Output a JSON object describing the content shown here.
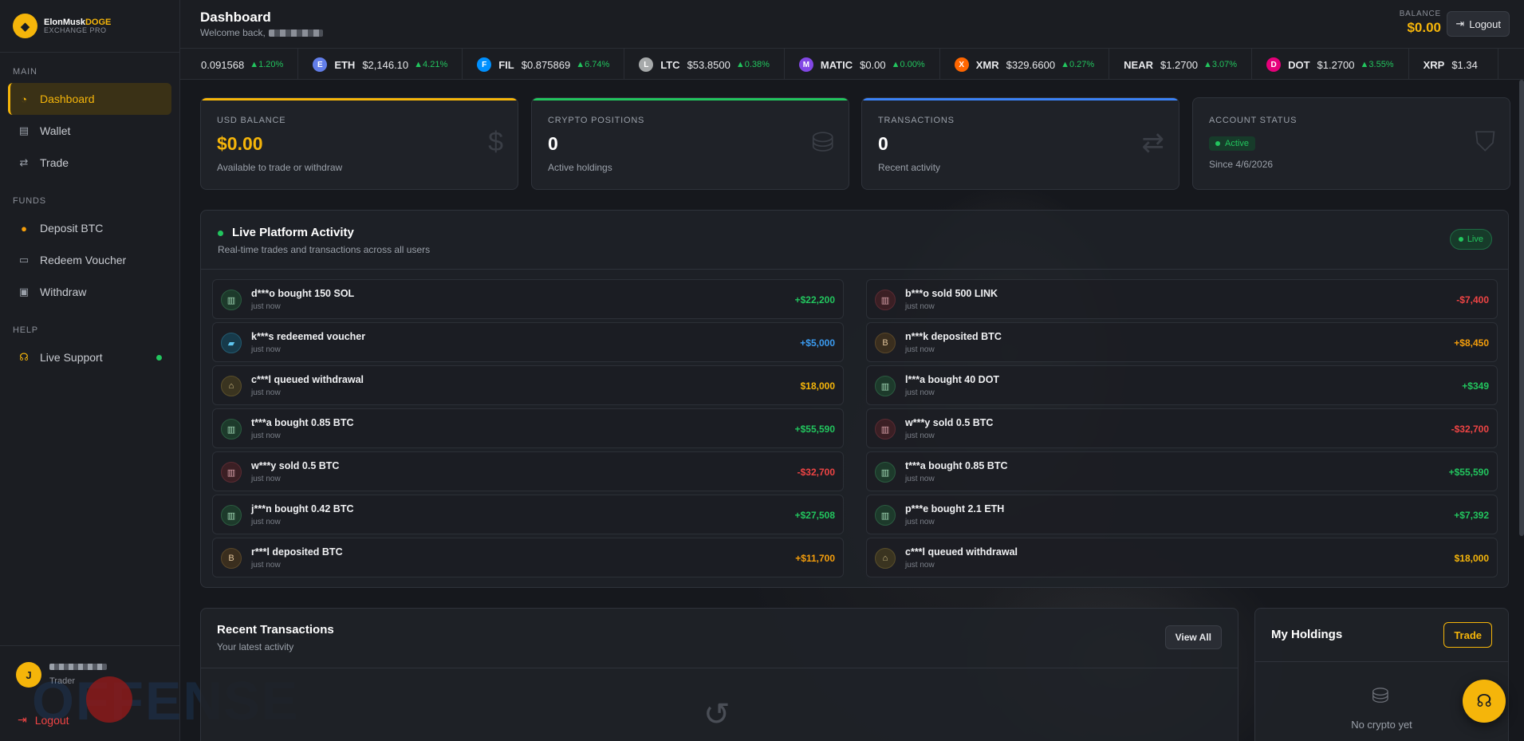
{
  "brand": {
    "name_main": "ElonMusk",
    "name_accent": "DOGE",
    "subtitle": "EXCHANGE PRO",
    "logo_icon": "doge-icon"
  },
  "sidebar": {
    "sections": [
      {
        "title": "MAIN",
        "items": [
          {
            "label": "Dashboard",
            "icon": "dashboard-icon",
            "active": true
          },
          {
            "label": "Wallet",
            "icon": "wallet-icon"
          },
          {
            "label": "Trade",
            "icon": "trade-arrows-icon"
          }
        ]
      },
      {
        "title": "FUNDS",
        "items": [
          {
            "label": "Deposit BTC",
            "icon": "bitcoin-icon"
          },
          {
            "label": "Redeem Voucher",
            "icon": "voucher-icon"
          },
          {
            "label": "Withdraw",
            "icon": "withdraw-icon"
          }
        ]
      },
      {
        "title": "HELP",
        "items": [
          {
            "label": "Live Support",
            "icon": "headset-icon",
            "online": true
          }
        ]
      }
    ],
    "user": {
      "initial": "J",
      "role": "Trader"
    },
    "watermark": "OFFENSE",
    "logout": "Logout"
  },
  "header": {
    "title": "Dashboard",
    "welcome": "Welcome back,",
    "balance_label": "BALANCE",
    "balance_value": "$0.00",
    "logout": "Logout"
  },
  "ticker": [
    {
      "symbol": "",
      "price": "0.091568",
      "change": "▲1.20%",
      "color": ""
    },
    {
      "symbol": "ETH",
      "price": "$2,146.10",
      "change": "▲4.21%",
      "color": "#627eea"
    },
    {
      "symbol": "FIL",
      "price": "$0.875869",
      "change": "▲6.74%",
      "color": "#0090ff"
    },
    {
      "symbol": "LTC",
      "price": "$53.8500",
      "change": "▲0.38%",
      "color": "#a6a9aa"
    },
    {
      "symbol": "MATIC",
      "price": "$0.00",
      "change": "▲0.00%",
      "color": "#8247e5"
    },
    {
      "symbol": "XMR",
      "price": "$329.6600",
      "change": "▲0.27%",
      "color": "#ff6600"
    },
    {
      "symbol": "NEAR",
      "price": "$1.2700",
      "change": "▲3.07%",
      "color": ""
    },
    {
      "symbol": "DOT",
      "price": "$1.2700",
      "change": "▲3.55%",
      "color": "#e6007a"
    },
    {
      "symbol": "XRP",
      "price": "$1.34",
      "change": "",
      "color": ""
    }
  ],
  "stats": [
    {
      "label": "USD BALANCE",
      "value": "$0.00",
      "sub": "Available to trade or withdraw",
      "accent": "#f5b50a",
      "icon": "dollar-icon"
    },
    {
      "label": "CRYPTO POSITIONS",
      "value": "0",
      "sub": "Active holdings",
      "accent": "#22c55e",
      "icon": "coins-icon"
    },
    {
      "label": "TRANSACTIONS",
      "value": "0",
      "sub": "Recent activity",
      "accent": "#3b82f6",
      "icon": "exchange-icon"
    },
    {
      "label": "ACCOUNT STATUS",
      "badge": "Active",
      "sub": "Since 4/6/2026",
      "icon": "shield-icon"
    }
  ],
  "activity": {
    "title": "Live Platform Activity",
    "subtitle": "Real-time trades and transactions across all users",
    "live_label": "Live",
    "left": [
      {
        "text": "d***o bought 150 SOL",
        "time": "just now",
        "amount": "+$22,200",
        "kind": "buy",
        "amt": "green"
      },
      {
        "text": "k***s redeemed voucher",
        "time": "just now",
        "amount": "+$5,000",
        "kind": "voucher",
        "amt": "blue"
      },
      {
        "text": "c***l queued withdrawal",
        "time": "just now",
        "amount": "$18,000",
        "kind": "withdraw",
        "amt": "yellow"
      },
      {
        "text": "t***a bought 0.85 BTC",
        "time": "just now",
        "amount": "+$55,590",
        "kind": "buy",
        "amt": "green"
      },
      {
        "text": "w***y sold 0.5 BTC",
        "time": "just now",
        "amount": "-$32,700",
        "kind": "sell",
        "amt": "red"
      },
      {
        "text": "j***n bought 0.42 BTC",
        "time": "just now",
        "amount": "+$27,508",
        "kind": "buy",
        "amt": "green"
      },
      {
        "text": "r***l deposited BTC",
        "time": "just now",
        "amount": "+$11,700",
        "kind": "deposit",
        "amt": "orange"
      }
    ],
    "right": [
      {
        "text": "b***o sold 500 LINK",
        "time": "just now",
        "amount": "-$7,400",
        "kind": "sell",
        "amt": "red"
      },
      {
        "text": "n***k deposited BTC",
        "time": "just now",
        "amount": "+$8,450",
        "kind": "deposit",
        "amt": "orange"
      },
      {
        "text": "l***a bought 40 DOT",
        "time": "just now",
        "amount": "+$349",
        "kind": "buy",
        "amt": "green"
      },
      {
        "text": "w***y sold 0.5 BTC",
        "time": "just now",
        "amount": "-$32,700",
        "kind": "sell",
        "amt": "red"
      },
      {
        "text": "t***a bought 0.85 BTC",
        "time": "just now",
        "amount": "+$55,590",
        "kind": "buy",
        "amt": "green"
      },
      {
        "text": "p***e bought 2.1 ETH",
        "time": "just now",
        "amount": "+$7,392",
        "kind": "buy",
        "amt": "green"
      },
      {
        "text": "c***l queued withdrawal",
        "time": "just now",
        "amount": "$18,000",
        "kind": "withdraw",
        "amt": "yellow"
      }
    ]
  },
  "recent": {
    "title": "Recent Transactions",
    "subtitle": "Your latest activity",
    "view_all": "View All"
  },
  "holdings": {
    "title": "My Holdings",
    "trade": "Trade",
    "empty": "No crypto yet"
  }
}
